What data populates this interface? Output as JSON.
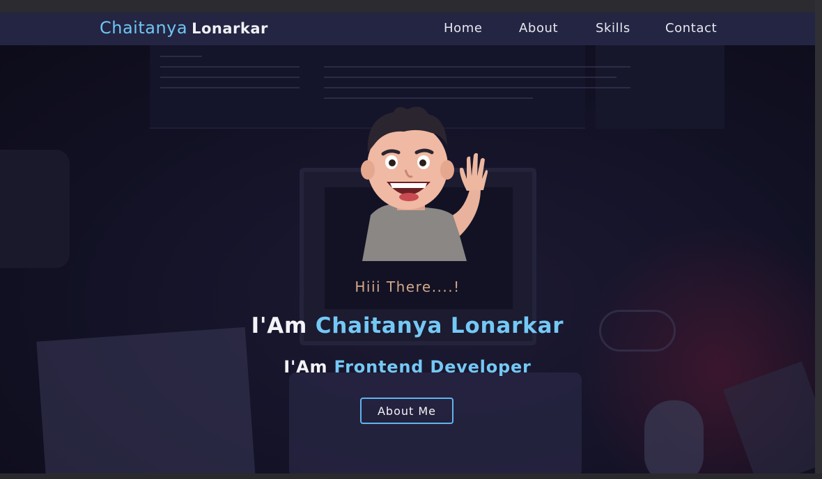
{
  "brand": {
    "first": "Chaitanya",
    "last": "Lonarkar"
  },
  "nav": {
    "items": [
      {
        "label": "Home"
      },
      {
        "label": "About"
      },
      {
        "label": "Skills"
      },
      {
        "label": "Contact"
      }
    ]
  },
  "hero": {
    "greeting": "Hiii There....!",
    "headline_prefix": "I'Am",
    "headline_name": "Chaitanya Lonarkar",
    "subline_prefix": "I'Am",
    "subline_role": "Frontend Developer",
    "button_label": "About Me"
  },
  "colors": {
    "accent": "#74c8f5",
    "navbar": "#242543",
    "greeting": "#d4a88a",
    "button_border": "#61b4f0"
  },
  "icons": {
    "avatar": "waving-cartoon-avatar"
  }
}
